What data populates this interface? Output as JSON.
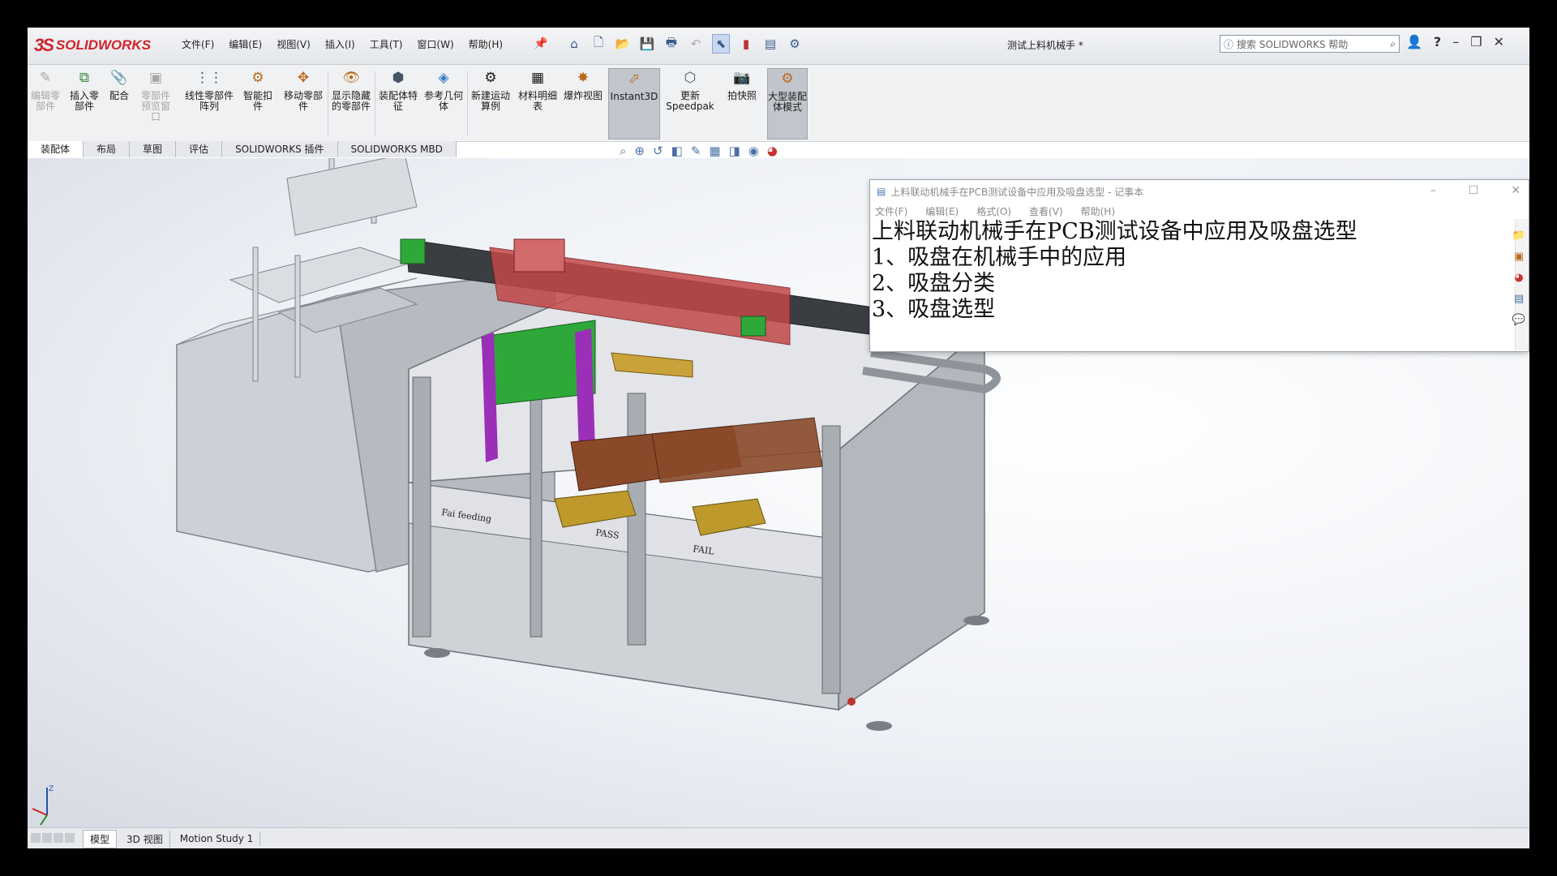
{
  "app": {
    "logo_text": "SOLIDWORKS",
    "document_title": "测试上料机械手 *",
    "search_placeholder": "搜索 SOLIDWORKS 帮助"
  },
  "menu": [
    "文件(F)",
    "编辑(E)",
    "视图(V)",
    "插入(I)",
    "工具(T)",
    "窗口(W)",
    "帮助(H)"
  ],
  "ribbon": {
    "items": [
      {
        "label": "编辑零部件",
        "icon": "edit-component-icon",
        "enabled": false
      },
      {
        "label": "插入零部件",
        "icon": "insert-component-icon",
        "enabled": true
      },
      {
        "label": "配合",
        "icon": "mate-icon",
        "enabled": true
      },
      {
        "label": "零部件预览窗口",
        "icon": "component-preview-icon",
        "enabled": false
      },
      {
        "label": "线性零部件阵列",
        "icon": "linear-pattern-icon",
        "enabled": true
      },
      {
        "label": "智能扣件",
        "icon": "smart-fastener-icon",
        "enabled": true
      },
      {
        "label": "移动零部件",
        "icon": "move-component-icon",
        "enabled": true
      },
      {
        "label": "显示隐藏的零部件",
        "icon": "show-hidden-icon",
        "enabled": true
      },
      {
        "label": "装配体特征",
        "icon": "assembly-feature-icon",
        "enabled": true
      },
      {
        "label": "参考几何体",
        "icon": "reference-geometry-icon",
        "enabled": true
      },
      {
        "label": "新建运动算例",
        "icon": "motion-study-icon",
        "enabled": true
      },
      {
        "label": "材料明细表",
        "icon": "bom-icon",
        "enabled": true
      },
      {
        "label": "爆炸视图",
        "icon": "exploded-view-icon",
        "enabled": true
      },
      {
        "label": "Instant3D",
        "icon": "instant3d-icon",
        "enabled": true,
        "active": true
      },
      {
        "label": "更新Speedpak",
        "icon": "speedpak-icon",
        "enabled": true
      },
      {
        "label": "拍快照",
        "icon": "snapshot-icon",
        "enabled": true
      },
      {
        "label": "大型装配体模式",
        "icon": "large-assembly-icon",
        "enabled": true,
        "active": true
      }
    ]
  },
  "tabs": [
    "装配体",
    "布局",
    "草图",
    "评估",
    "SOLIDWORKS 插件",
    "SOLIDWORKS MBD"
  ],
  "active_tab": "装配体",
  "notepad": {
    "title": "上料联动机械手在PCB测试设备中应用及吸盘选型 - 记事本",
    "menu": [
      "文件(F)",
      "编辑(E)",
      "格式(O)",
      "查看(V)",
      "帮助(H)"
    ],
    "lines": [
      "上料联动机械手在PCB测试设备中应用及吸盘选型",
      "1、吸盘在机械手中的应用",
      "2、吸盘分类",
      "3、吸盘选型"
    ]
  },
  "model_labels": [
    "Fai feeding",
    "PASS",
    "FAIL"
  ],
  "bottom_tabs": [
    "模型",
    "3D 视图",
    "Motion Study 1"
  ],
  "active_bottom_tab": "模型",
  "colors": {
    "brand": "#d2232a",
    "frame": "#8c9097",
    "rail": "#b53a3a",
    "green_part": "#2fa83a",
    "purple_part": "#9b2fb8",
    "copper": "#8a4a2a"
  }
}
